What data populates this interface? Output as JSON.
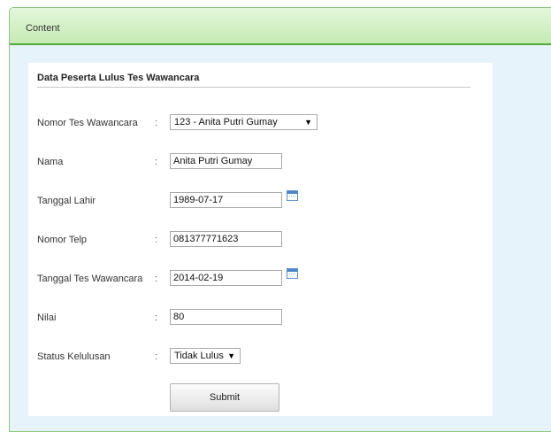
{
  "panel": {
    "title": "Content"
  },
  "form": {
    "heading": "Data Peserta Lulus Tes Wawancara",
    "separator": ":",
    "fields": {
      "nomor_tes": {
        "label": "Nomor Tes Wawancara",
        "selected": "123 - Anita Putri Gumay"
      },
      "nama": {
        "label": "Nama",
        "value": "Anita Putri Gumay"
      },
      "tanggal_lahir": {
        "label": "Tanggal Lahir",
        "value": "1989-07-17",
        "icon": "calendar-icon"
      },
      "nomor_telp": {
        "label": "Nomor Telp",
        "value": "081377771623"
      },
      "tanggal_tes": {
        "label": "Tanggal Tes Wawancara",
        "value": "2014-02-19",
        "icon": "calendar-icon"
      },
      "nilai": {
        "label": "Nilai",
        "value": "80"
      },
      "status": {
        "label": "Status Kelulusan",
        "selected": "Tidak Lulus"
      }
    },
    "submit_label": "Submit"
  },
  "colors": {
    "header_green": "#d3f0c5",
    "header_border": "#4fae3a",
    "panel_bg": "#e6f3fb",
    "calendar_blue": "#4a86c8"
  }
}
